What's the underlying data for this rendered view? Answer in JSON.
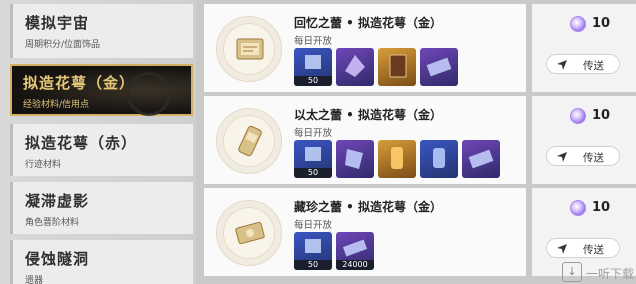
{
  "categories": [
    {
      "title": "模拟宇宙",
      "subtitle": "周期积分/位面饰品",
      "active": false
    },
    {
      "title": "拟造花萼（金）",
      "subtitle": "经验材料/信用点",
      "active": true
    },
    {
      "title": "拟造花萼（赤）",
      "subtitle": "行迹材料",
      "active": false
    },
    {
      "title": "凝滞虚影",
      "subtitle": "角色晋阶材料",
      "active": false
    },
    {
      "title": "侵蚀隧洞",
      "subtitle": "遗器",
      "active": false
    }
  ],
  "rows": [
    {
      "title": "回忆之蕾 • 拟造花萼（金）",
      "subtitle": "每日开放",
      "cost": "10",
      "button": "传送",
      "items": [
        {
          "color": "blue",
          "qty": "50"
        },
        {
          "color": "purple",
          "qty": ""
        },
        {
          "color": "gold",
          "qty": ""
        },
        {
          "color": "purple",
          "qty": ""
        }
      ]
    },
    {
      "title": "以太之蕾 • 拟造花萼（金）",
      "subtitle": "每日开放",
      "cost": "10",
      "button": "传送",
      "items": [
        {
          "color": "blue",
          "qty": "50"
        },
        {
          "color": "purple",
          "qty": ""
        },
        {
          "color": "gold",
          "qty": ""
        },
        {
          "color": "blue",
          "qty": ""
        },
        {
          "color": "purple",
          "qty": ""
        }
      ]
    },
    {
      "title": "藏珍之蕾 • 拟造花萼（金）",
      "subtitle": "每日开放",
      "cost": "10",
      "button": "传送",
      "items": [
        {
          "color": "blue",
          "qty": "50"
        },
        {
          "color": "purple",
          "qty": "24000"
        }
      ]
    }
  ],
  "watermark": "一听下载"
}
